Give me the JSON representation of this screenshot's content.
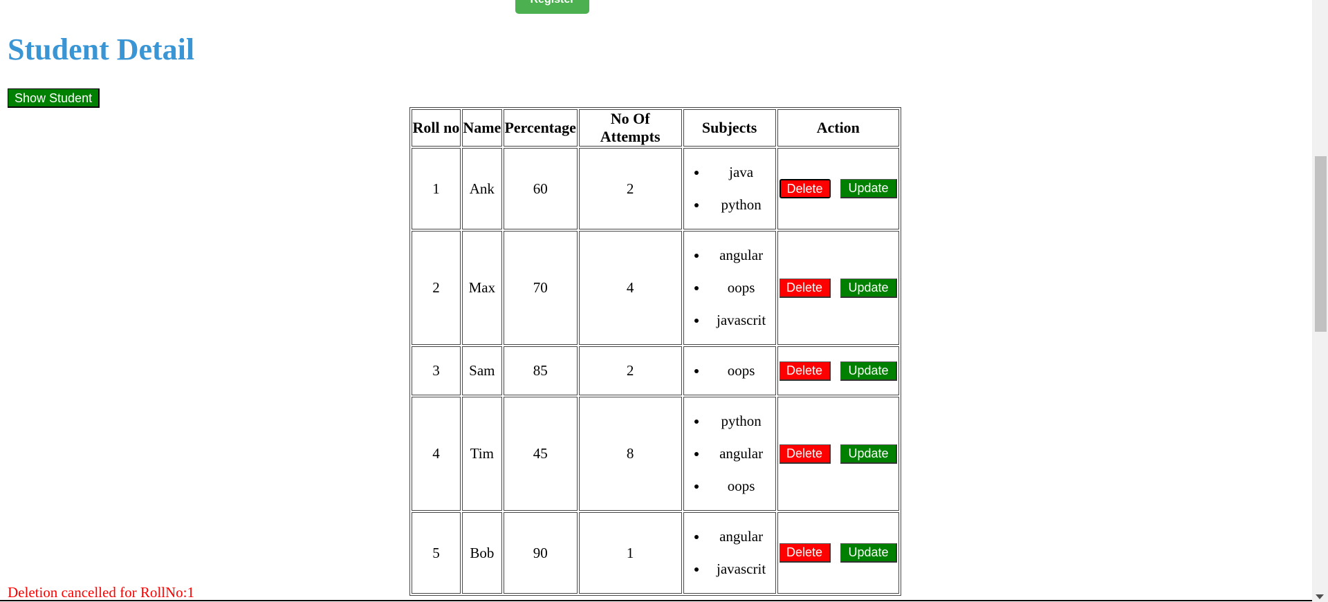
{
  "top": {
    "register_label": "Register"
  },
  "header": {
    "title": "Student Detail"
  },
  "toolbar": {
    "show_student_label": "Show Student"
  },
  "table": {
    "headers": [
      "Roll no",
      "Name",
      "Percentage",
      "No Of Attempts",
      "Subjects",
      "Action"
    ],
    "rows": [
      {
        "roll": "1",
        "name": "Ank",
        "percentage": "60",
        "attempts": "2",
        "subjects": [
          "java",
          "python"
        ]
      },
      {
        "roll": "2",
        "name": "Max",
        "percentage": "70",
        "attempts": "4",
        "subjects": [
          "angular",
          "oops",
          "javascrit"
        ]
      },
      {
        "roll": "3",
        "name": "Sam",
        "percentage": "85",
        "attempts": "2",
        "subjects": [
          "oops"
        ]
      },
      {
        "roll": "4",
        "name": "Tim",
        "percentage": "45",
        "attempts": "8",
        "subjects": [
          "python",
          "angular",
          "oops"
        ]
      },
      {
        "roll": "5",
        "name": "Bob",
        "percentage": "90",
        "attempts": "1",
        "subjects": [
          "angular",
          "javascrit"
        ]
      }
    ],
    "delete_label": "Delete",
    "update_label": "Update"
  },
  "status": {
    "message": "Deletion cancelled for RollNo:1"
  },
  "colors": {
    "title": "#3a95d5",
    "delete": "#ff0000",
    "update": "#008000",
    "register": "#4caf50",
    "status": "#ff0000"
  }
}
